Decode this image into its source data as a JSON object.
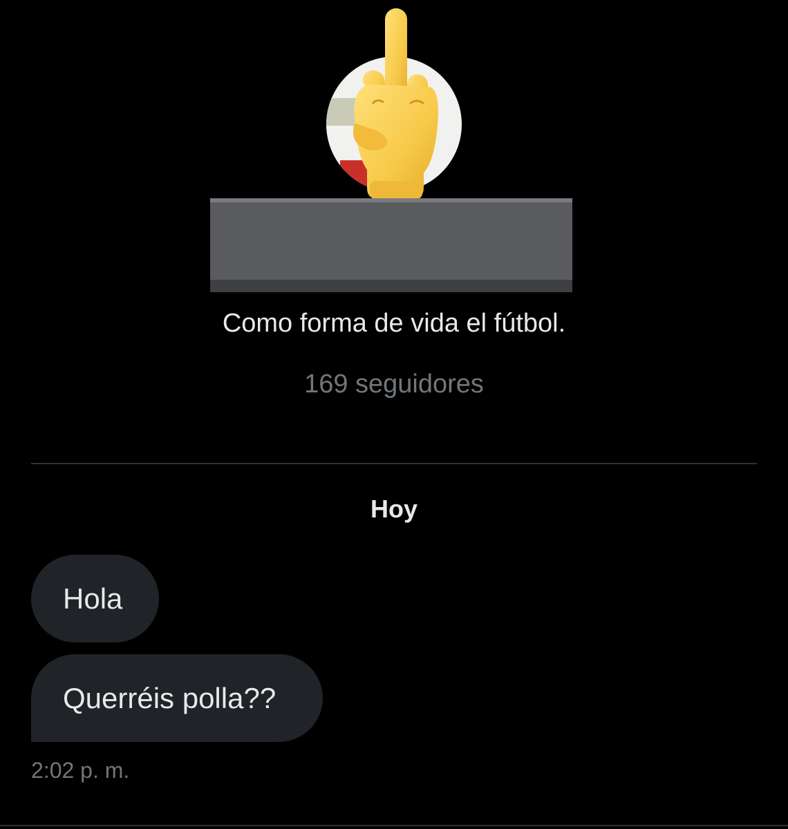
{
  "profile": {
    "avatar_icon": "profile-photo",
    "overlay_icon": "middle-finger-emoji",
    "redaction": "gray-box",
    "bio": "Como forma de vida el fútbol.",
    "followers": "169 seguidores"
  },
  "conversation": {
    "date_label": "Hoy",
    "messages": [
      {
        "text": "Hola"
      },
      {
        "text": "Querréis polla??"
      }
    ],
    "timestamp": "2:02 p. m."
  },
  "colors": {
    "background": "#000000",
    "bubble": "#202327",
    "primary_text": "#e7e9ea",
    "secondary_text": "#71767b",
    "divider": "#2f3336",
    "redaction": "#5a5b5e",
    "emoji": "#f7c948"
  }
}
